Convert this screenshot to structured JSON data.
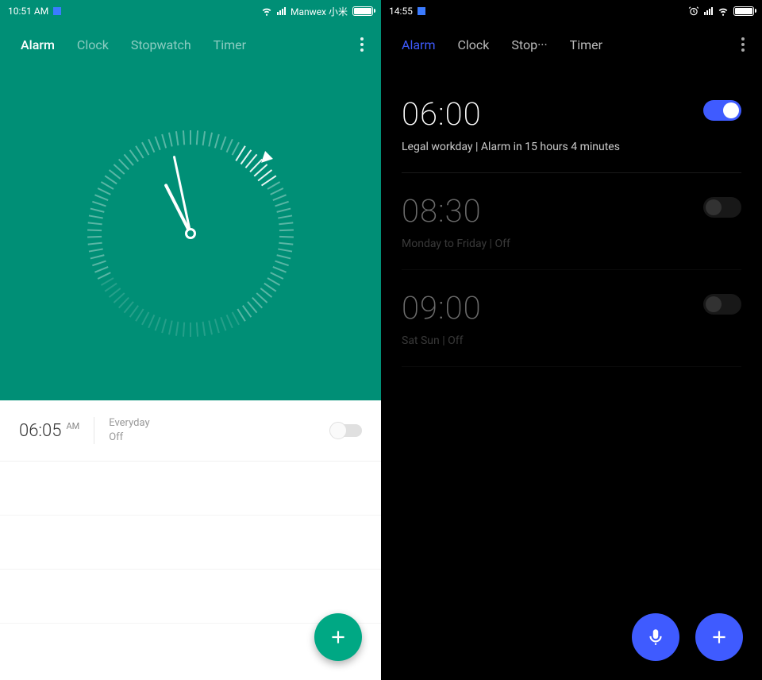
{
  "left": {
    "status": {
      "time": "10:51 AM",
      "carrier": "Manwex 小米"
    },
    "tabs": [
      "Alarm",
      "Clock",
      "Stopwatch",
      "Timer"
    ],
    "active_tab": 0,
    "alarm": {
      "time": "06:05",
      "ampm": "AM",
      "repeat": "Everyday",
      "state": "Off",
      "enabled": false
    },
    "fab_icon": "plus"
  },
  "right": {
    "status": {
      "time": "14:55"
    },
    "tabs": [
      "Alarm",
      "Clock",
      "Stop···",
      "Timer"
    ],
    "active_tab": 0,
    "alarms": [
      {
        "time": "06:00",
        "sub": "Legal workday  |  Alarm in 15 hours 4 minutes",
        "enabled": true
      },
      {
        "time": "08:30",
        "sub": "Monday to Friday  |  Off",
        "enabled": false
      },
      {
        "time": "09:00",
        "sub": "Sat Sun  |  Off",
        "enabled": false
      }
    ],
    "fab_mic": "mic",
    "fab_plus": "plus"
  },
  "colors": {
    "teal": "#008f76",
    "blue": "#3f5bff"
  }
}
